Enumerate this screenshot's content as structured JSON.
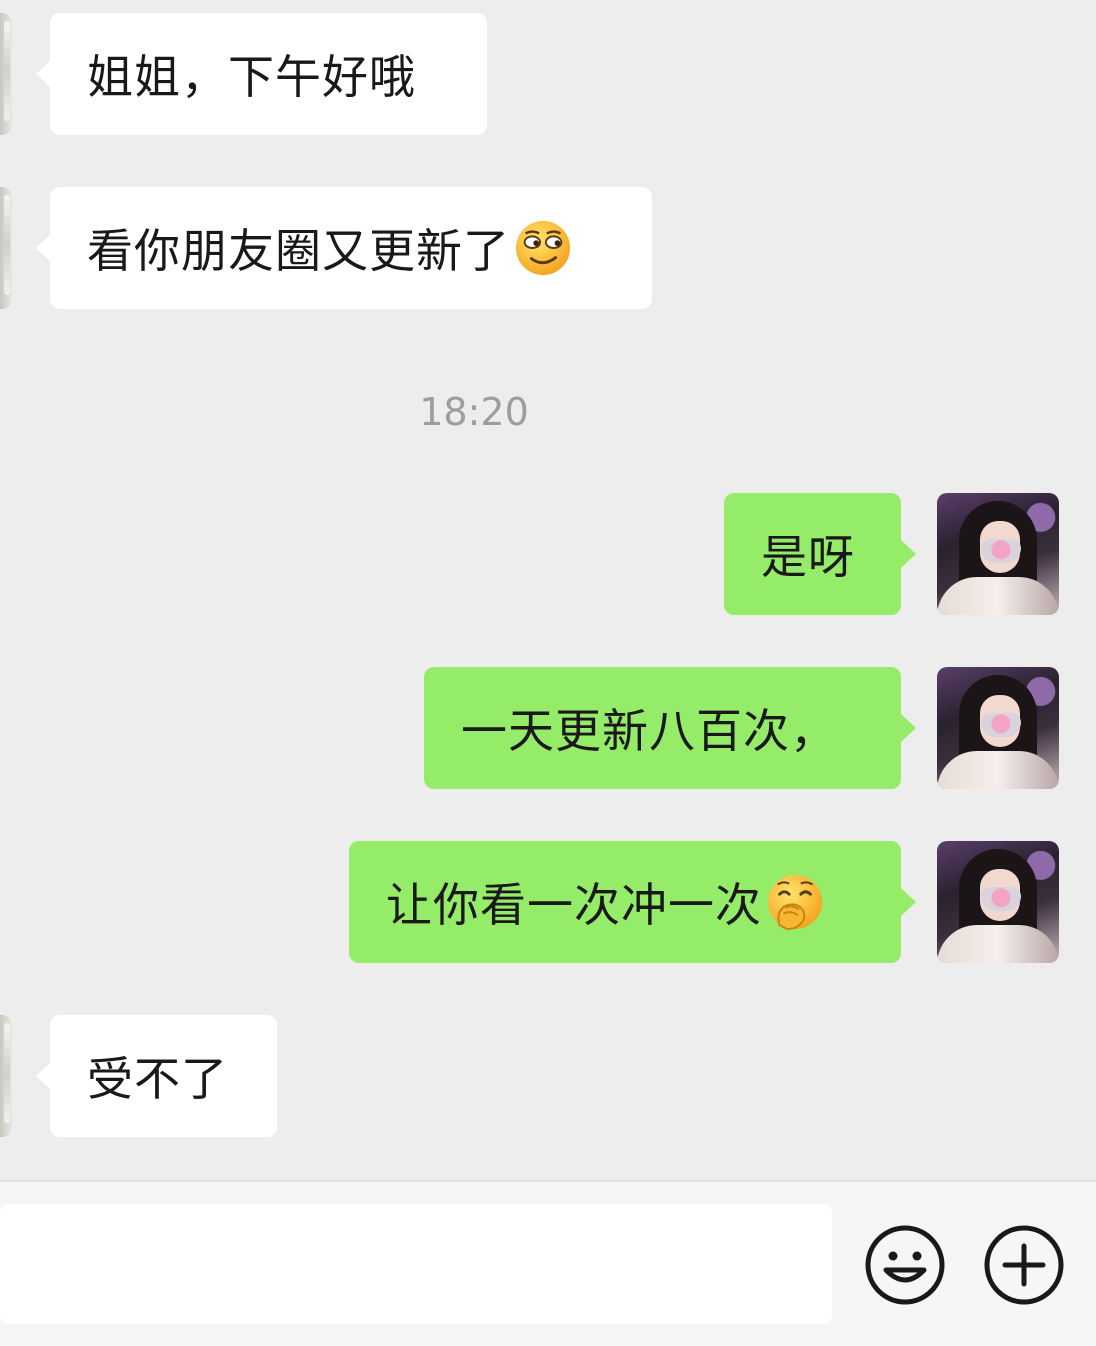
{
  "time_divider": "18:20",
  "messages": [
    {
      "side": "received",
      "text": "姐姐，下午好哦",
      "emoji": null
    },
    {
      "side": "received",
      "text": "看你朋友圈又更新了",
      "emoji": "smirk-emoji"
    },
    {
      "side": "sent",
      "text": "是呀",
      "emoji": null
    },
    {
      "side": "sent",
      "text": "一天更新八百次，",
      "emoji": null
    },
    {
      "side": "sent",
      "text": "让你看一次冲一次",
      "emoji": "hand-over-mouth-emoji"
    },
    {
      "side": "received",
      "text": "受不了",
      "emoji": null
    }
  ],
  "composer": {
    "input_value": "",
    "icons": [
      "smile-icon",
      "plus-icon"
    ]
  },
  "colors": {
    "background": "#ededed",
    "received_bubble": "#ffffff",
    "sent_bubble": "#95ec69",
    "time_text": "#9d9d9d",
    "text": "#191919"
  }
}
